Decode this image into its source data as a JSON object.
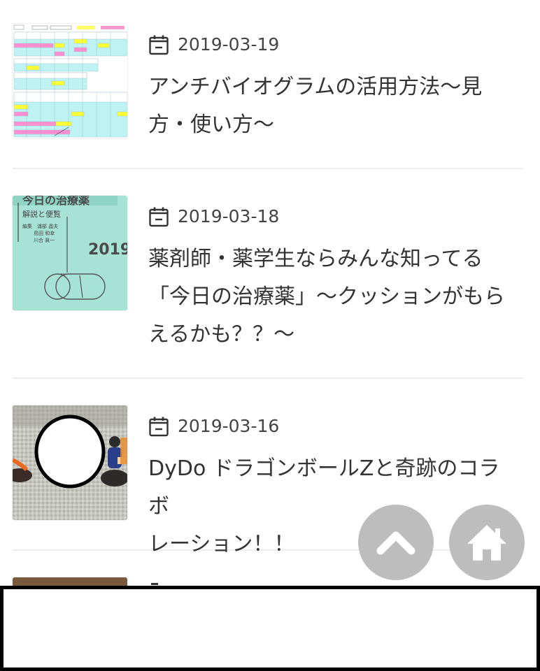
{
  "articles": [
    {
      "date": "2019-03-19",
      "title_lines": [
        "アンチバイオグラムの活用方法〜見",
        "方・使い方〜"
      ]
    },
    {
      "date": "2019-03-18",
      "title_lines": [
        "薬剤師・薬学生ならみんな知ってる",
        "「今日の治療薬」〜クッションがもら",
        "えるかも？？〜"
      ],
      "thumb_label": "2019"
    },
    {
      "date": "2019-03-16",
      "title_lines": [
        "DyDo ドラゴンボールZと奇跡のコラボ",
        "レーション！！"
      ]
    }
  ],
  "fabs": {
    "scroll_top_icon": "chevron-up-icon",
    "home_icon": "home-icon"
  },
  "colors": {
    "fab": "#bdbdbd",
    "thumb_mint": "#a7e3d4",
    "divider": "#eeeeee"
  }
}
